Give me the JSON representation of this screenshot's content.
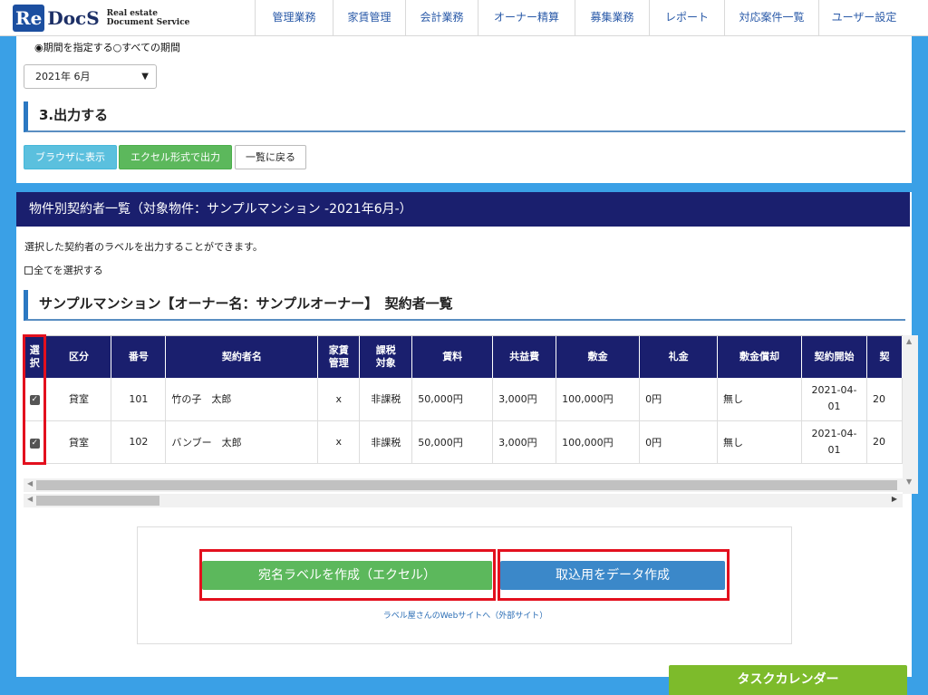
{
  "logo": {
    "re": "Re",
    "docs": "DocS",
    "tag1": "Real estate",
    "tag2": "Document Service"
  },
  "nav": [
    {
      "label": "管理業務"
    },
    {
      "label": "家賃管理"
    },
    {
      "label": "会計業務"
    },
    {
      "label": "オーナー精算"
    },
    {
      "label": "募集業務"
    },
    {
      "label": "レポート"
    },
    {
      "label": "対応案件一覧"
    },
    {
      "label": "ユーザー設定"
    }
  ],
  "period": {
    "radio_specified": "◉期間を指定する",
    "radio_all": "○すべての期間",
    "selected_month": "2021年 6月"
  },
  "output_section": {
    "title": "3.出力する",
    "btn_browser": "ブラウザに表示",
    "btn_excel": "エクセル形式で出力",
    "btn_back": "一覧に戻る"
  },
  "list_panel": {
    "bar_title": "物件別契約者一覧（対象物件：サンプルマンション -2021年6月-）",
    "description": "選択した契約者のラベルを出力することができます。",
    "select_all": "全てを選択する",
    "section_title": "サンプルマンション【オーナー名：サンプルオーナー】　契約者一覧"
  },
  "table": {
    "headers": {
      "select_1": "選",
      "select_2": "択",
      "kubun": "区分",
      "bango": "番号",
      "name": "契約者名",
      "kanri_1": "家賃",
      "kanri_2": "管理",
      "kazei_1": "課税",
      "kazei_2": "対象",
      "rent": "賃料",
      "common": "共益費",
      "deposit": "敷金",
      "key": "礼金",
      "dep_amort": "敷金償却",
      "start": "契約開始",
      "end_partial": "契"
    },
    "rows": [
      {
        "checked": "✓",
        "kubun": "貸室",
        "bango": "101",
        "name": "竹の子　太郎",
        "kanri": "x",
        "kazei": "非課税",
        "rent": "50,000円",
        "common": "3,000円",
        "deposit": "100,000円",
        "key": "0円",
        "dep_amort": "無し",
        "start_1": "2021-04-",
        "start_2": "01",
        "end_partial": "20"
      },
      {
        "checked": "✓",
        "kubun": "貸室",
        "bango": "102",
        "name": "バンブー　太郎",
        "kanri": "x",
        "kazei": "非課税",
        "rent": "50,000円",
        "common": "3,000円",
        "deposit": "100,000円",
        "key": "0円",
        "dep_amort": "無し",
        "start_1": "2021-04-",
        "start_2": "01",
        "end_partial": "20"
      }
    ]
  },
  "actions": {
    "btn_label_excel": "宛名ラベルを作成（エクセル）",
    "btn_import": "取込用をデータ作成",
    "external_link": "ラベル屋さんのWebサイトへ（外部サイト）"
  },
  "task_calendar": "タスクカレンダー",
  "colors": {
    "navy": "#1a1f6e",
    "accent_blue": "#3aa0e6",
    "success": "#5cb85c",
    "highlight_red": "#e3101e",
    "calendar_green": "#7dbb2b"
  }
}
